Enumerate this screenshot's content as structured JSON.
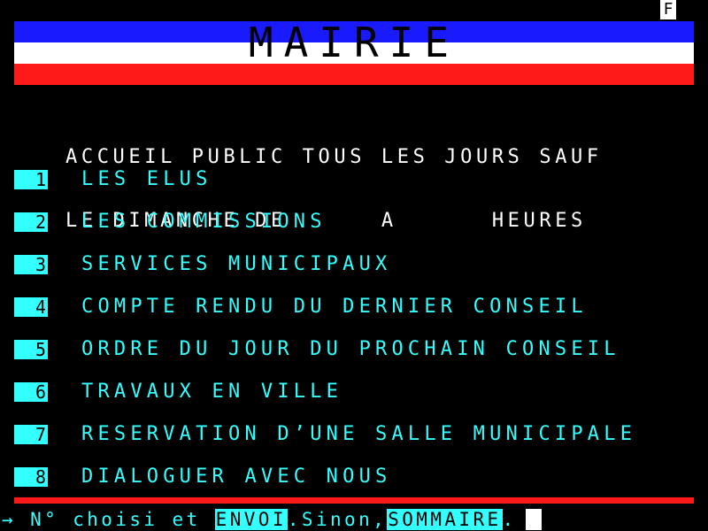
{
  "status_indicator": "F",
  "title": "MAIRIE",
  "info_lines": [
    "ACCUEIL PUBLIC TOUS LES JOURS SAUF",
    "LE DIMANCHE DE      A      HEURES"
  ],
  "menu": [
    {
      "num": "1",
      "label": "LES ELUS"
    },
    {
      "num": "2",
      "label": "LES COMMISSIONS"
    },
    {
      "num": "3",
      "label": "SERVICES MUNICIPAUX"
    },
    {
      "num": "4",
      "label": "COMPTE RENDU DU DERNIER CONSEIL"
    },
    {
      "num": "5",
      "label": "ORDRE DU JOUR DU PROCHAIN CONSEIL"
    },
    {
      "num": "6",
      "label": "TRAVAUX EN VILLE"
    },
    {
      "num": "7",
      "label": "RESERVATION D’UNE SALLE MUNICIPALE"
    },
    {
      "num": "8",
      "label": "DIALOGUER AVEC NOUS"
    }
  ],
  "footer": {
    "prompt": "→ N° choisi et ",
    "send_key": "ENVOI",
    "middle": ".Sinon,",
    "summary_key": "SOMMAIRE",
    "end": "."
  },
  "colors": {
    "background": "#000000",
    "cyan": "#33ffff",
    "blue": "#1a1aff",
    "red": "#ff1a1a",
    "white": "#ffffff"
  }
}
